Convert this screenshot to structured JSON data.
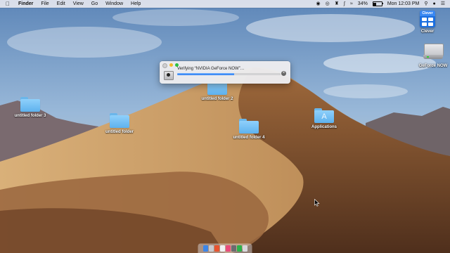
{
  "menubar": {
    "app_name": "Finder",
    "menus": [
      "File",
      "Edit",
      "View",
      "Go",
      "Window",
      "Help"
    ],
    "status_icons": [
      "screen-record-icon",
      "malwarebytes-icon",
      "cleanup-icon",
      "bluetooth-icon",
      "wifi-icon"
    ],
    "battery_percent": "34%",
    "battery_level": 0.34,
    "clock": "Mon 12:03 PM",
    "spotlight_icon": "search-icon",
    "control_icon": "control-center-icon",
    "list_icon": "notification-list-icon"
  },
  "dialog": {
    "title": "Verifying “NVIDIA GeForce NOW”…",
    "progress": 0.55,
    "icon": "disk-image-icon",
    "stop_icon": "stop-icon"
  },
  "desktop": {
    "folders": [
      {
        "label": "untitled folder 3"
      },
      {
        "label": "untitled folder"
      },
      {
        "label": "untitled folder 2"
      },
      {
        "label": "untitled folder 4"
      },
      {
        "label": "Applications"
      }
    ],
    "apps": [
      {
        "label": "Clever",
        "badge": "Clever"
      },
      {
        "label": "GeForce NOW"
      }
    ]
  },
  "colors": {
    "folder_blue": "#6ab6ea",
    "progress_blue": "#2a7cf0",
    "clever_blue": "#1b6fe0"
  }
}
